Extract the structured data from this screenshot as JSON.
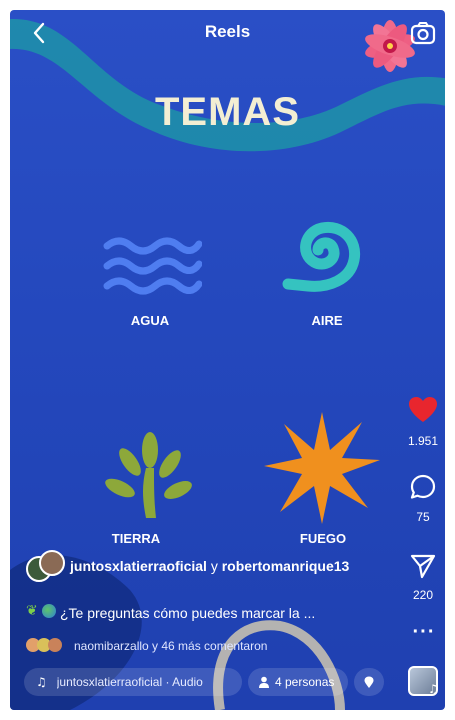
{
  "header": {
    "title": "Reels"
  },
  "banner": {
    "title": "TEMAS"
  },
  "themes": [
    {
      "label": "AGUA"
    },
    {
      "label": "AIRE"
    },
    {
      "label": "TIERRA"
    },
    {
      "label": "FUEGO"
    }
  ],
  "actions": {
    "likes": "1.951",
    "comments": "75",
    "shares": "220"
  },
  "post": {
    "author_primary": "juntosxlatierraoficial",
    "author_joiner": " y ",
    "author_secondary": "robertomanrique13",
    "caption": "¿Te preguntas cómo puedes marcar la ...",
    "comments_summary": "naomibarzallo y 46 más comentaron"
  },
  "footer": {
    "audio": "juntosxlatierraoficial · Audio",
    "people": "4 personas"
  },
  "colors": {
    "background": "#2448bd",
    "water": "#4f7df0",
    "air": "#35c3c0",
    "earth": "#8da83a",
    "fire": "#f0901e",
    "like": "#e8262e"
  }
}
